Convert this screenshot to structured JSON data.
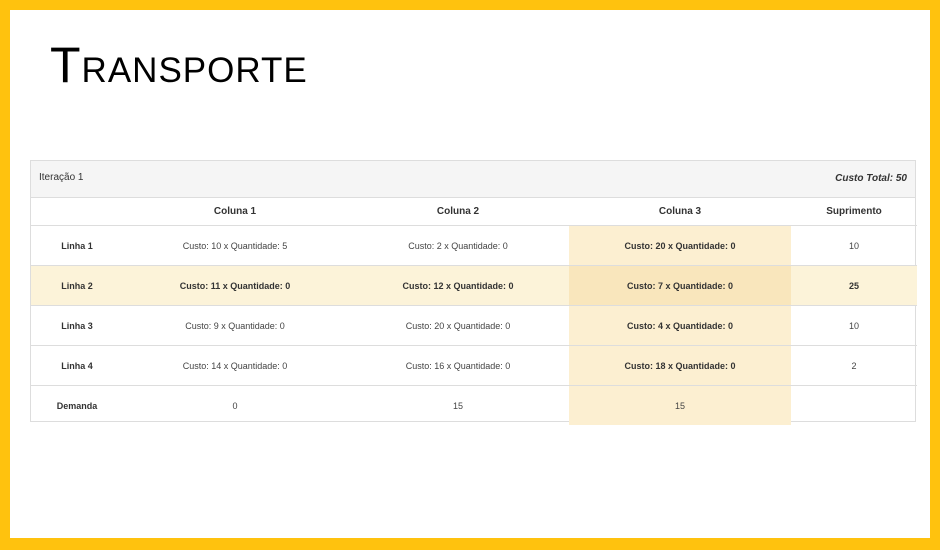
{
  "page": {
    "title": "Transporte"
  },
  "panel": {
    "iteration_label": "Iteração 1",
    "total_cost_label": "Custo Total: 50"
  },
  "table": {
    "headers": [
      "",
      "Coluna 1",
      "Coluna 2",
      "Coluna 3",
      "Suprimento"
    ],
    "rows": [
      {
        "label": "Linha 1",
        "cells": [
          "Custo: 10 x Quantidade: 5",
          "Custo: 2 x Quantidade: 0",
          "Custo: 20 x Quantidade: 0"
        ],
        "supply": "10"
      },
      {
        "label": "Linha 2",
        "cells": [
          "Custo: 11 x Quantidade: 0",
          "Custo: 12 x Quantidade: 0",
          "Custo: 7 x Quantidade: 0"
        ],
        "supply": "25"
      },
      {
        "label": "Linha 3",
        "cells": [
          "Custo: 9 x Quantidade: 0",
          "Custo: 20 x Quantidade: 0",
          "Custo: 4 x Quantidade: 0"
        ],
        "supply": "10"
      },
      {
        "label": "Linha 4",
        "cells": [
          "Custo: 14 x Quantidade: 0",
          "Custo: 16 x Quantidade: 0",
          "Custo: 18 x Quantidade: 0"
        ],
        "supply": "2"
      }
    ],
    "demand": {
      "label": "Demanda",
      "values": [
        "0",
        "15",
        "15"
      ],
      "supply": ""
    }
  },
  "colors": {
    "border": "#ffc20e",
    "highlight_row": "#fcf3d9",
    "highlight_col": "#fcefd1"
  }
}
